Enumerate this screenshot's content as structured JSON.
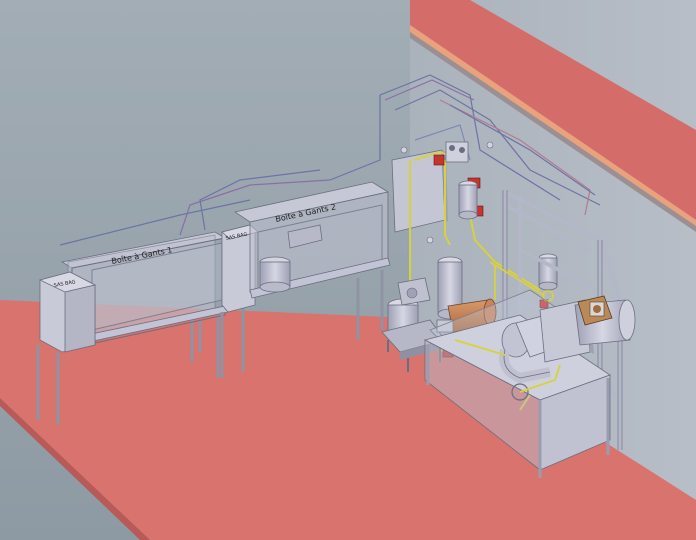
{
  "scene": {
    "glovebox_1_label": "Boîte à Gants 1",
    "glovebox_2_label": "Boîte à Gants 2",
    "airlock_1_label": "SAS BAG",
    "airlock_2_label": "SAS BAG"
  },
  "colors": {
    "floor": "#d9736d",
    "wall": "#a9b1bb",
    "wall_stripe": "#d46d6a",
    "wall_stripe_edge": "#e9a27b",
    "sky": "#9aa6ae",
    "equipment": "#c2c3d4",
    "equipment_dark": "#8f90a2",
    "frame": "#b8bccb",
    "pipe_yellow": "#d8d23a",
    "valve_red": "#c8332e"
  }
}
